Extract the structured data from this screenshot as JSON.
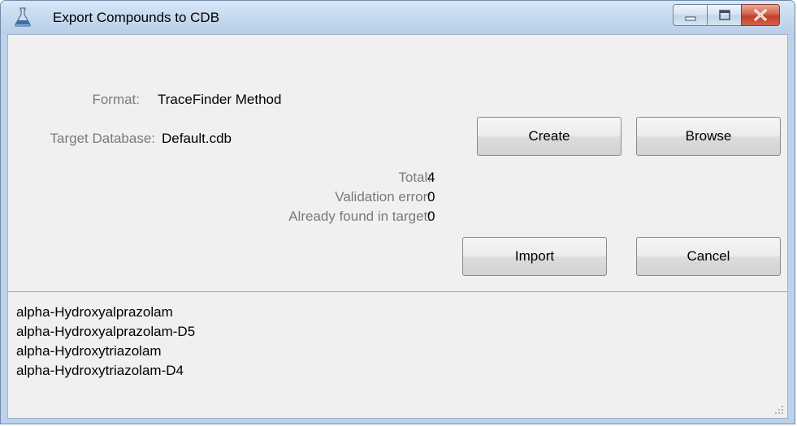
{
  "window": {
    "title": "Export Compounds to CDB",
    "controls": {
      "minimize_icon": "minimize-icon",
      "maximize_icon": "maximize-icon",
      "close_icon": "close-icon"
    }
  },
  "form": {
    "format_label": "Format:",
    "format_value": "TraceFinder Method",
    "target_label": "Target Database:",
    "target_value": "Default.cdb"
  },
  "buttons": {
    "create": "Create",
    "browse": "Browse",
    "import": "Import",
    "cancel": "Cancel"
  },
  "stats": {
    "total_label": "Total:",
    "total_value": "4",
    "validation_label": "Validation error:",
    "validation_value": "0",
    "found_label": "Already found in target:",
    "found_value": "0"
  },
  "compounds": [
    "alpha-Hydroxyalprazolam",
    "alpha-Hydroxyalprazolam-D5",
    "alpha-Hydroxytriazolam",
    "alpha-Hydroxytriazolam-D4"
  ],
  "colors": {
    "accent_close": "#c2402a",
    "title_bar": "#c6d9ee",
    "client_bg": "#f0f0f0"
  }
}
